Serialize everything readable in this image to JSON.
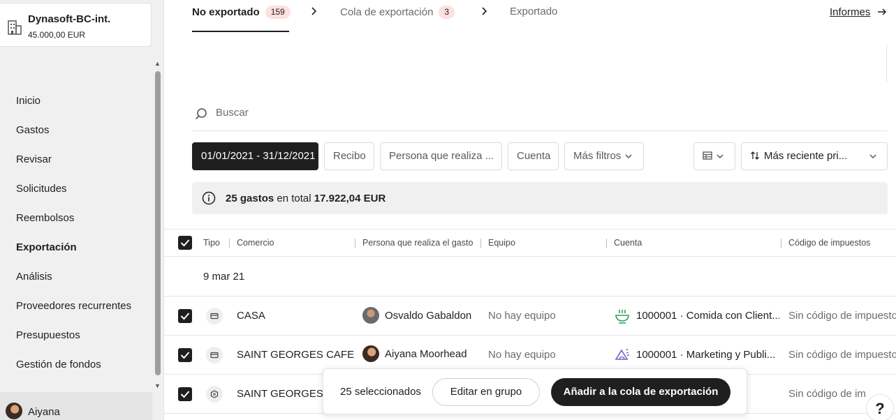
{
  "company": {
    "name": "Dynasoft-BC-int.",
    "balance": "45.000,00",
    "currency": "EUR"
  },
  "nav": {
    "items": [
      "Inicio",
      "Gastos",
      "Revisar",
      "Solicitudes",
      "Reembolsos",
      "Exportación",
      "Análisis",
      "Proveedores recurrentes",
      "Presupuestos",
      "Gestión de fondos"
    ],
    "active": "Exportación"
  },
  "user": {
    "name": "Aiyana"
  },
  "tabs": [
    {
      "label": "No exportado",
      "count": "159"
    },
    {
      "label": "Cola de exportación",
      "count": "3"
    },
    {
      "label": "Exportado"
    }
  ],
  "reports_link": "Informes",
  "search": {
    "placeholder": "Buscar"
  },
  "filters": {
    "date_range": "01/01/2021 - 31/12/2021",
    "receipt": "Recibo",
    "spender": "Persona que realiza ...",
    "account": "Cuenta",
    "more": "Más filtros",
    "sort": "Más reciente pri..."
  },
  "summary": {
    "count": "25 gastos",
    "middle": " en total ",
    "amount": "17.922,04 EUR"
  },
  "table": {
    "headers": [
      "Tipo",
      "Comercio",
      "Persona que realiza el gasto",
      "Equipo",
      "Cuenta",
      "Código de impuestos"
    ],
    "group_date": "9 mar 21",
    "rows": [
      {
        "merchant": "CASA",
        "spender": "Osvaldo Gabaldon",
        "team": "No hay equipo",
        "account": "1000001 · Comida con Client...",
        "tax": "Sin código de impuestos"
      },
      {
        "merchant": "SAINT GEORGES CAFE",
        "spender": "Aiyana Moorhead",
        "team": "No hay equipo",
        "account": "1000001 · Marketing y Publi...",
        "tax": "Sin código de impuestos"
      },
      {
        "merchant": "SAINT GEORGES C",
        "spender": "",
        "team": "",
        "account": "",
        "tax": "Sin código de im"
      }
    ]
  },
  "bulk_bar": {
    "selected": "25 seleccionados",
    "edit": "Editar en grupo",
    "add": "Añadir a la cola de exportación"
  },
  "help": "?",
  "colors": {
    "dark": "#1f1f1f",
    "badge": "#fde0e0",
    "sidebar": "#f0f0f0",
    "account_green": "#2e9e5b",
    "account_purple": "#6f63c8"
  }
}
